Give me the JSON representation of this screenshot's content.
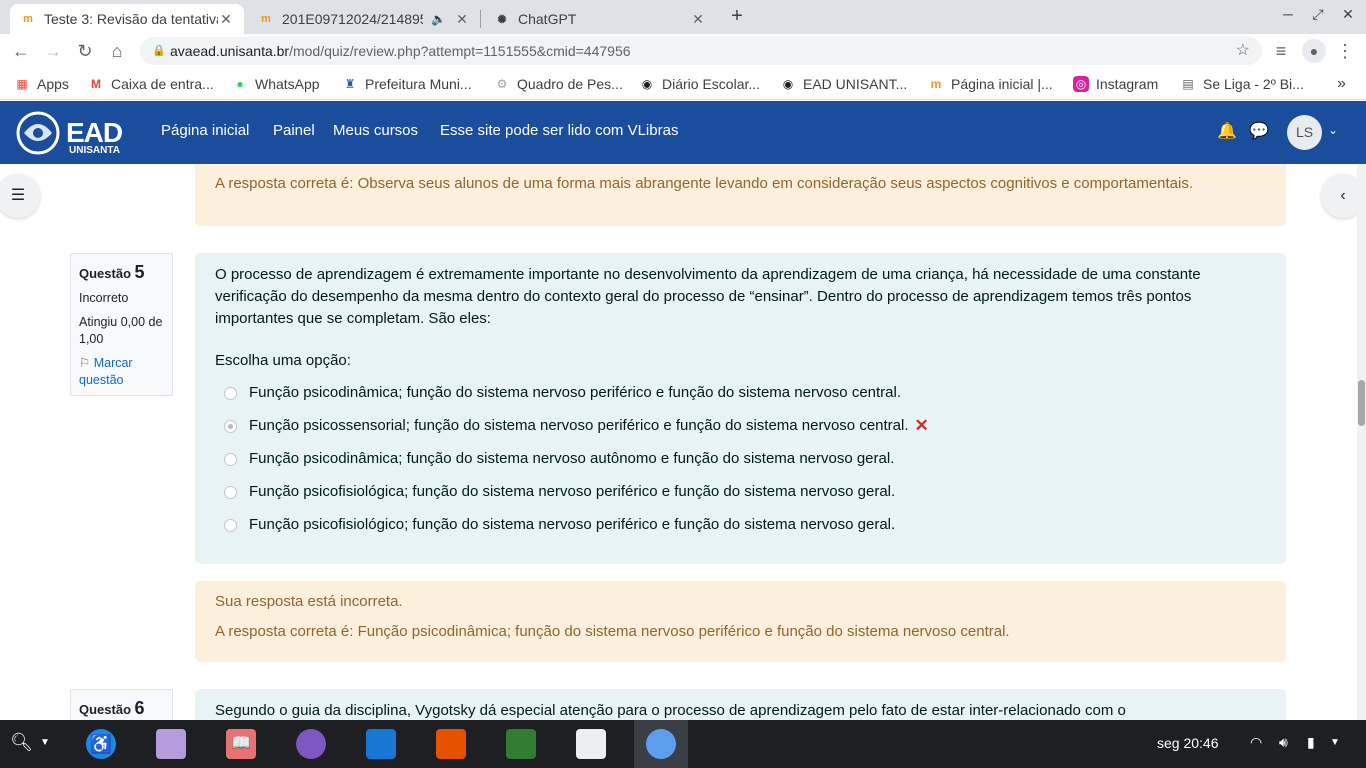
{
  "browser": {
    "tabs": [
      {
        "title": "Teste 3: Revisão da tentativa",
        "active": true
      },
      {
        "title": "201E09712024/214895",
        "audio": true
      },
      {
        "title": "ChatGPT"
      }
    ],
    "url_domain": "avaead.unisanta.br",
    "url_path": "/mod/quiz/review.php?attempt=1151555&cmid=447956",
    "bookmarks": [
      "Apps",
      "Caixa de entra...",
      "WhatsApp",
      "Prefeitura Muni...",
      "Quadro de Pes...",
      "Diário Escolar...",
      "EAD UNISANT...",
      "Página inicial |...",
      "Instagram",
      "Se Liga - 2º Bi..."
    ],
    "more_bookmarks": "»"
  },
  "site": {
    "logo_text": "EAD",
    "logo_sub": "UNISANTA",
    "nav": [
      "Página inicial",
      "Painel",
      "Meus cursos",
      "Esse site pode ser lido com VLibras"
    ],
    "user_initials": "LS"
  },
  "prev_feedback": {
    "correct_answer": "A resposta correta é: Observa seus alunos de uma forma mais abrangente levando em consideração seus aspectos cognitivos e comportamentais."
  },
  "question5": {
    "label": "Questão",
    "number": "5",
    "status": "Incorreto",
    "grade": "Atingiu 0,00 de 1,00",
    "flag": "Marcar questão",
    "text": "O processo de aprendizagem é extremamente importante no desenvolvimento da aprendizagem de  uma criança, há necessidade de uma constante verificação do desempenho da mesma dentro do contexto geral do processo de “ensinar”. Dentro do processo de aprendizagem temos três pontos importantes que se completam. São eles:",
    "prompt": "Escolha uma opção:",
    "options": [
      {
        "text": "Função psicodinâmica; função do sistema nervoso periférico e função do sistema nervoso central.",
        "selected": false
      },
      {
        "text": "Função psicossensorial; função do sistema nervoso periférico e função do sistema nervoso central.",
        "selected": true,
        "incorrect": true
      },
      {
        "text": "Função psicodinâmica; função do sistema nervoso autônomo e função do sistema nervoso geral.",
        "selected": false
      },
      {
        "text": "Função psicofisiológica; função do sistema nervoso periférico e função do sistema nervoso geral.",
        "selected": false
      },
      {
        "text": "Função psicofisiológico; função do sistema nervoso periférico e função do sistema nervoso geral.",
        "selected": false
      }
    ],
    "feedback": "Sua resposta está incorreta.",
    "correct_answer": "A resposta correta é: Função psicodinâmica; função do sistema nervoso periférico e função do sistema nervoso central."
  },
  "question6": {
    "label": "Questão",
    "number": "6",
    "text": "Segundo o guia da disciplina, Vygotsky dá especial atenção para o processo de aprendizagem pelo fato de estar inter-relacionado com o"
  },
  "taskbar": {
    "clock": "seg 20:46"
  }
}
